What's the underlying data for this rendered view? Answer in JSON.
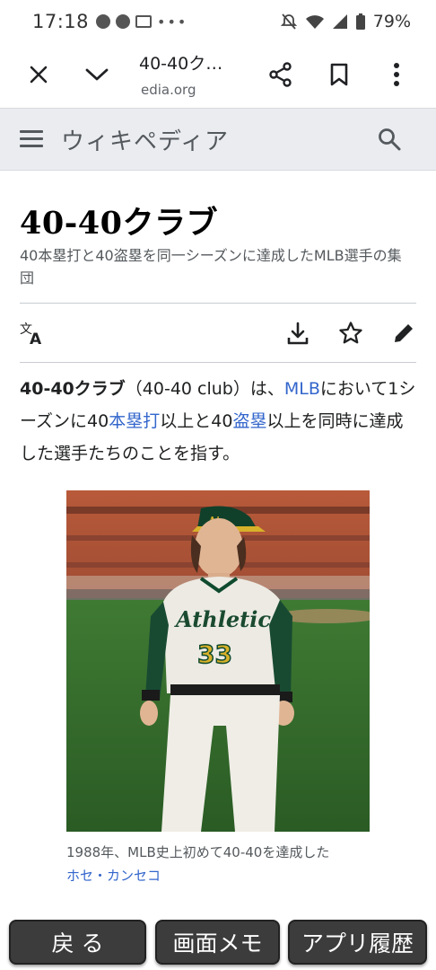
{
  "status_bar": {
    "time": "17:18",
    "battery": "79%"
  },
  "toolbar": {
    "title": "40-40ク…",
    "domain": "edia.org",
    "icons": [
      "close-icon",
      "chevron-down-icon",
      "share-icon",
      "bookmark-icon",
      "more-vert-icon"
    ]
  },
  "wiki_header": {
    "logo": "ウィキペディア"
  },
  "article": {
    "title": "40-40クラブ",
    "description": "40本塁打と40盗塁を同一シーズンに達成したMLB選手の集団",
    "lead": {
      "p1": "40-40クラブ",
      "p2": "（40-40 club）は、",
      "p3": "MLB",
      "p4": "において1シーズンに40",
      "p5": "本塁打",
      "p6": "以上と40",
      "p7": "盗塁",
      "p8": "以上を同時に達成した選手たちのことを指す。"
    },
    "image": {
      "jersey_text": "Athletics",
      "jersey_number": "33",
      "cap_text": "A's"
    },
    "caption": {
      "text": "1988年、MLB史上初めて40-40を達成した",
      "link": "ホセ・カンセコ"
    }
  },
  "bottom_buttons": {
    "back": "戻 る",
    "memo": "画面メモ",
    "history": "アプリ履歴"
  }
}
